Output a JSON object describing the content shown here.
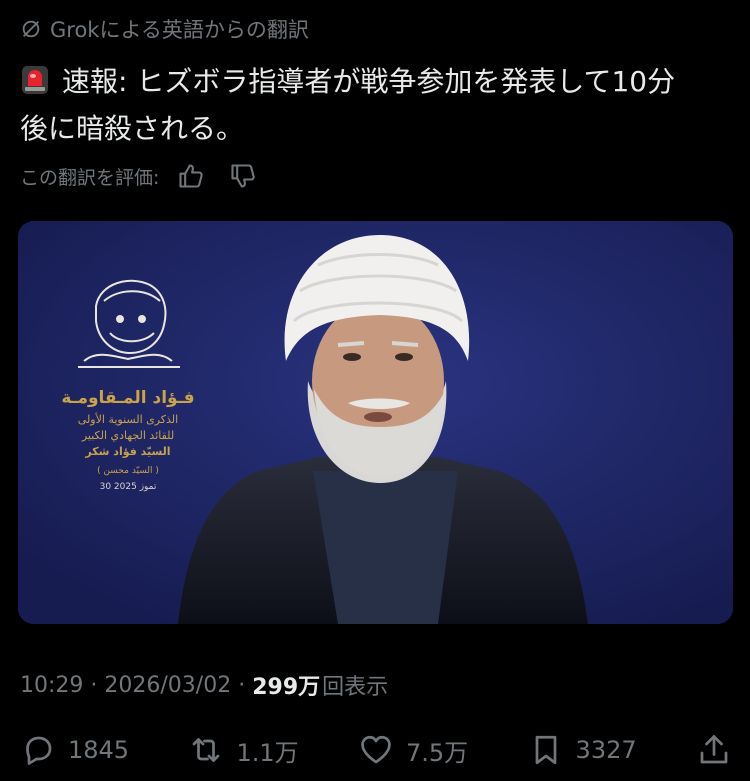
{
  "translation_note": "Grokによる英語からの翻訳",
  "tweet": {
    "line1": "速報: ヒズボラ指導者が戦争参加を発表して10分",
    "line2": "後に暗殺される。"
  },
  "rate": {
    "label": "この翻訳を評価:"
  },
  "media": {
    "logo_title": "فـؤاد المـقاومـة",
    "logo_line1": "الذكرى السنوية الأولى",
    "logo_line2": "للقائد الجهادي الكبير",
    "logo_line3": "السيّد فؤاد شكر",
    "logo_line4": "( السيّد محسن )",
    "logo_date": "30 تموز 2025"
  },
  "meta": {
    "time": "10:29",
    "separator": "·",
    "date": "2026/03/02",
    "views_count": "299万",
    "views_label": "回表示"
  },
  "actions": {
    "replies": "1845",
    "reposts": "1.1万",
    "likes": "7.5万",
    "bookmarks": "3327"
  },
  "colors": {
    "background": "#000000",
    "text": "#e7e9ea",
    "muted": "#71767b",
    "media_background": "#1d2463",
    "siren_red": "#e8232d"
  },
  "icons": [
    "grok-icon",
    "siren-icon",
    "thumbs-up-icon",
    "thumbs-down-icon",
    "reply-icon",
    "repost-icon",
    "like-icon",
    "bookmark-icon",
    "share-icon"
  ]
}
